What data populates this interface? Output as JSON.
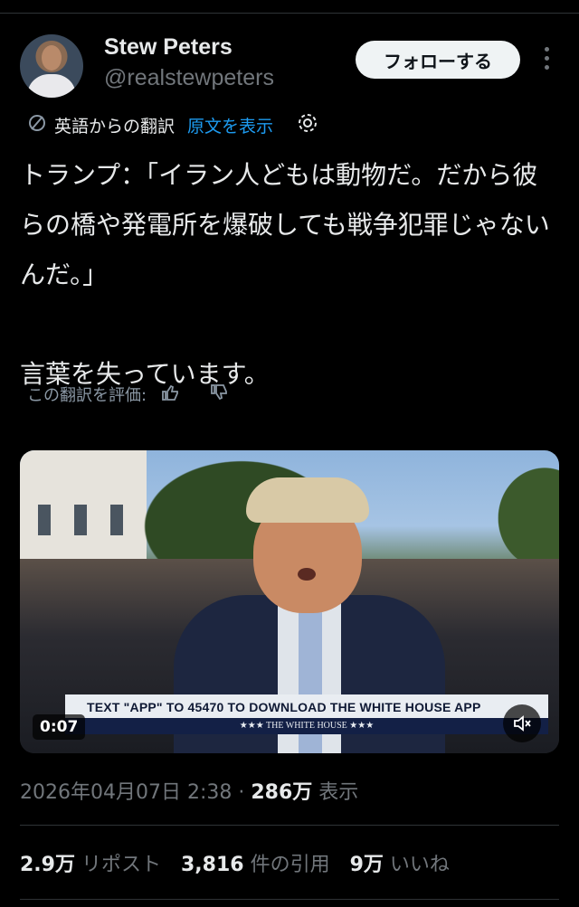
{
  "author": {
    "name": "Stew Peters",
    "handle": "@realstewpeters",
    "follow_label": "フォローする"
  },
  "translation": {
    "label": "英語からの翻訳",
    "show_original": "原文を表示"
  },
  "tweet": {
    "text": "トランプ：「イラン人どもは動物だ。だから彼らの橋や発電所を爆破しても戦争犯罪じゃないんだ。」\n\n言葉を失っています。"
  },
  "rate_translation": "この翻訳を評価:",
  "video": {
    "banner_text": "TEXT \"APP\" TO 45470 TO DOWNLOAD THE WHITE HOUSE APP",
    "banner_sub": "★★★  THE WHITE HOUSE  ★★★",
    "duration": "0:07"
  },
  "meta": {
    "timestamp": "2026年04月07日 2:38",
    "sep": " · ",
    "views": "286万",
    "views_label": " 表示"
  },
  "stats": {
    "reposts": "2.9万",
    "reposts_label": " リポスト",
    "quotes": "3,816",
    "quotes_label": " 件の引用",
    "likes": "9万",
    "likes_label": " いいね"
  },
  "icons": {
    "translate": "translate-icon",
    "settings": "gear-icon",
    "thumbs_up": "thumbs-up-icon",
    "thumbs_down": "thumbs-down-icon",
    "more": "more-vertical-icon",
    "mute": "mute-icon"
  },
  "colors": {
    "accent": "#1d9bf0",
    "text": "#e7e9ea",
    "muted": "#71767b"
  }
}
